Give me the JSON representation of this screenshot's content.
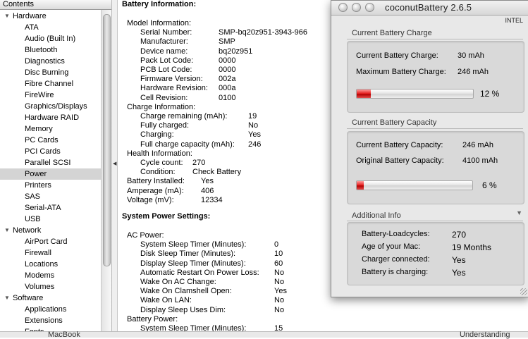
{
  "sidebar": {
    "header": "Contents",
    "tree": [
      {
        "type": "group",
        "label": "Hardware"
      },
      {
        "type": "item",
        "label": "ATA"
      },
      {
        "type": "item",
        "label": "Audio (Built In)"
      },
      {
        "type": "item",
        "label": "Bluetooth"
      },
      {
        "type": "item",
        "label": "Diagnostics"
      },
      {
        "type": "item",
        "label": "Disc Burning"
      },
      {
        "type": "item",
        "label": "Fibre Channel"
      },
      {
        "type": "item",
        "label": "FireWire"
      },
      {
        "type": "item",
        "label": "Graphics/Displays"
      },
      {
        "type": "item",
        "label": "Hardware RAID"
      },
      {
        "type": "item",
        "label": "Memory"
      },
      {
        "type": "item",
        "label": "PC Cards"
      },
      {
        "type": "item",
        "label": "PCI Cards"
      },
      {
        "type": "item",
        "label": "Parallel SCSI"
      },
      {
        "type": "item",
        "label": "Power",
        "selected": true
      },
      {
        "type": "item",
        "label": "Printers"
      },
      {
        "type": "item",
        "label": "SAS"
      },
      {
        "type": "item",
        "label": "Serial-ATA"
      },
      {
        "type": "item",
        "label": "USB"
      },
      {
        "type": "group",
        "label": "Network"
      },
      {
        "type": "item",
        "label": "AirPort Card"
      },
      {
        "type": "item",
        "label": "Firewall"
      },
      {
        "type": "item",
        "label": "Locations"
      },
      {
        "type": "item",
        "label": "Modems"
      },
      {
        "type": "item",
        "label": "Volumes"
      },
      {
        "type": "group",
        "label": "Software"
      },
      {
        "type": "item",
        "label": "Applications"
      },
      {
        "type": "item",
        "label": "Extensions"
      },
      {
        "type": "item",
        "label": "Fonts"
      }
    ]
  },
  "detail": {
    "battery_title": "Battery Information:",
    "lines": [
      {
        "indent": 0,
        "label": "Model Information:"
      },
      {
        "indent": 1,
        "label": "Serial Number:",
        "value": "SMP-bq20z951-3943-966"
      },
      {
        "indent": 1,
        "label": "Manufacturer:",
        "value": "SMP"
      },
      {
        "indent": 1,
        "label": "Device name:",
        "value": "bq20z951"
      },
      {
        "indent": 1,
        "label": "Pack Lot Code:",
        "value": "0000"
      },
      {
        "indent": 1,
        "label": "PCB Lot Code:",
        "value": "0000"
      },
      {
        "indent": 1,
        "label": "Firmware Version:",
        "value": "002a"
      },
      {
        "indent": 1,
        "label": "Hardware Revision:",
        "value": "000a"
      },
      {
        "indent": 1,
        "label": "Cell Revision:",
        "value": "0100"
      },
      {
        "indent": 0,
        "label": "Charge Information:"
      },
      {
        "indent": 1,
        "label": "Charge remaining (mAh):",
        "value": "19"
      },
      {
        "indent": 1,
        "label": "Fully charged:",
        "value": "No"
      },
      {
        "indent": 1,
        "label": "Charging:",
        "value": "Yes"
      },
      {
        "indent": 1,
        "label": "Full charge capacity (mAh):",
        "value": "246"
      },
      {
        "indent": 0,
        "label": "Health Information:"
      },
      {
        "indent": 1,
        "label": "Cycle count:",
        "value": "270"
      },
      {
        "indent": 1,
        "label": "Condition:",
        "value": "Check Battery"
      },
      {
        "indent": 0,
        "label": "Battery Installed:",
        "value": "Yes"
      },
      {
        "indent": 0,
        "label": "Amperage (mA):",
        "value": "406"
      },
      {
        "indent": 0,
        "label": "Voltage (mV):",
        "value": "12334"
      }
    ],
    "power_title": "System Power Settings:",
    "power_lines": [
      {
        "indent": 0,
        "label": "AC Power:"
      },
      {
        "indent": 1,
        "label": "System Sleep Timer (Minutes):",
        "value": "0"
      },
      {
        "indent": 1,
        "label": "Disk Sleep Timer (Minutes):",
        "value": "10"
      },
      {
        "indent": 1,
        "label": "Display Sleep Timer (Minutes):",
        "value": "60"
      },
      {
        "indent": 1,
        "label": "Automatic Restart On Power Loss:",
        "value": "No"
      },
      {
        "indent": 1,
        "label": "Wake On AC Change:",
        "value": "No"
      },
      {
        "indent": 1,
        "label": "Wake On Clamshell Open:",
        "value": "Yes"
      },
      {
        "indent": 1,
        "label": "Wake On LAN:",
        "value": "No"
      },
      {
        "indent": 1,
        "label": "Display Sleep Uses Dim:",
        "value": "No"
      },
      {
        "indent": 0,
        "label": "Battery Power:"
      },
      {
        "indent": 1,
        "label": "System Sleep Timer (Minutes):",
        "value": "15"
      }
    ]
  },
  "bottom_strip": {
    "left": "MacBook",
    "right": "Understanding"
  },
  "coconut": {
    "title": "coconutBattery 2.6.5",
    "cpu": "INTEL",
    "charge": {
      "section": "Current Battery Charge",
      "current_label": "Current Battery Charge:",
      "current_value": "30 mAh",
      "max_label": "Maximum Battery Charge:",
      "max_value": "246 mAh",
      "percent": 12,
      "percent_text": "12 %"
    },
    "capacity": {
      "section": "Current Battery Capacity",
      "current_label": "Current Battery Capacity:",
      "current_value": "246 mAh",
      "original_label": "Original Battery Capacity:",
      "original_value": "4100 mAh",
      "percent": 6,
      "percent_text": "6 %"
    },
    "info": {
      "section": "Additional Info",
      "rows": [
        {
          "label": "Battery-Loadcycles:",
          "value": "270"
        },
        {
          "label": "Age of your Mac:",
          "value": "19 Months"
        },
        {
          "label": "Charger connected:",
          "value": "Yes"
        },
        {
          "label": "Battery is charging:",
          "value": "Yes"
        }
      ]
    }
  }
}
